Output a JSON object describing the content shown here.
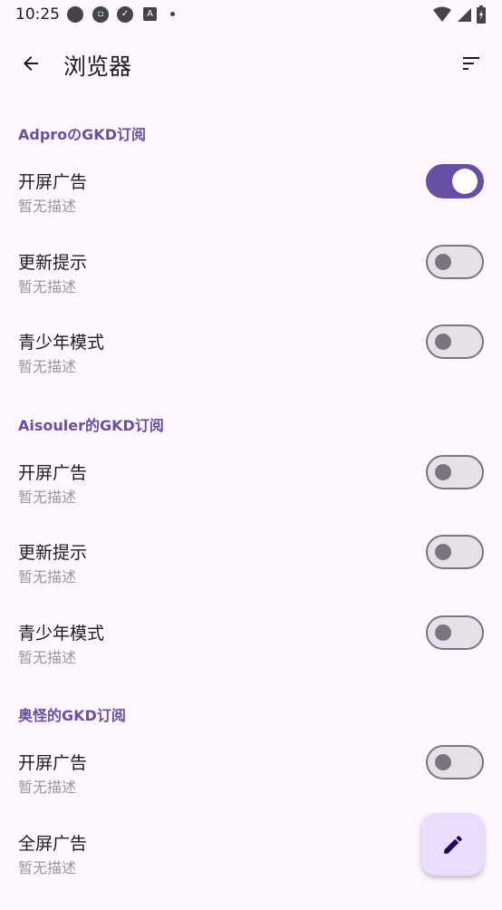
{
  "status": {
    "time": "10:25"
  },
  "header": {
    "title": "浏览器"
  },
  "groups": [
    {
      "name": "AdproのGKD订阅",
      "items": [
        {
          "title": "开屏广告",
          "desc": "暂无描述",
          "enabled": true
        },
        {
          "title": "更新提示",
          "desc": "暂无描述",
          "enabled": false
        },
        {
          "title": "青少年模式",
          "desc": "暂无描述",
          "enabled": false
        }
      ]
    },
    {
      "name": "Aisouler的GKD订阅",
      "items": [
        {
          "title": "开屏广告",
          "desc": "暂无描述",
          "enabled": false
        },
        {
          "title": "更新提示",
          "desc": "暂无描述",
          "enabled": false
        },
        {
          "title": "青少年模式",
          "desc": "暂无描述",
          "enabled": false
        }
      ]
    },
    {
      "name": "奥怪的GKD订阅",
      "items": [
        {
          "title": "开屏广告",
          "desc": "暂无描述",
          "enabled": false
        },
        {
          "title": "全屏广告",
          "desc": "暂无描述",
          "enabled": null
        }
      ]
    }
  ],
  "colors": {
    "primary": "#6750a4",
    "background": "#fef7ff",
    "fab": "#eaddff"
  },
  "icons": {
    "back": "arrow-back-icon",
    "sort": "sort-icon",
    "fab": "edit-icon"
  }
}
